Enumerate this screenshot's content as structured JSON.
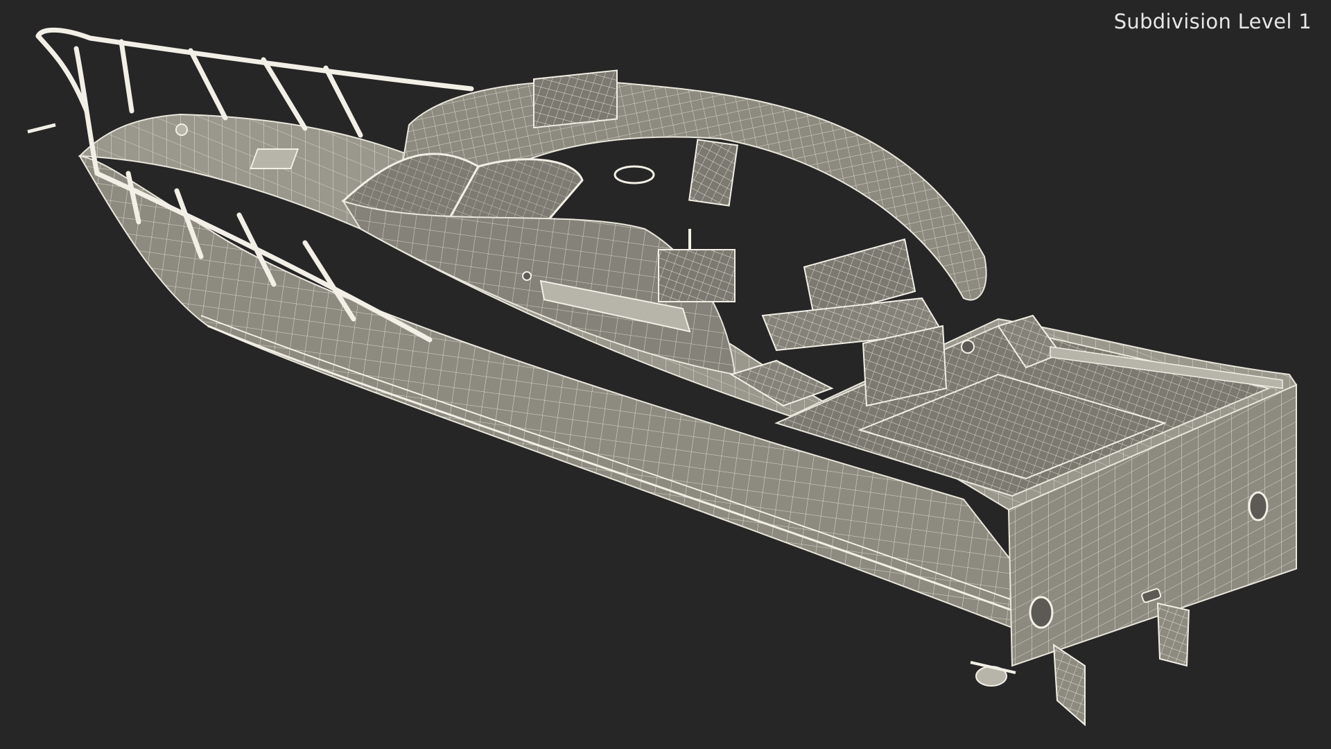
{
  "viewport": {
    "label": "Subdivision Level 1",
    "background": "#262626"
  },
  "model": {
    "fill": "#8d8b80",
    "fill_dark": "#6f6d64",
    "wire": "#e9e7dc",
    "wire_faint": "#cfcdc2"
  }
}
